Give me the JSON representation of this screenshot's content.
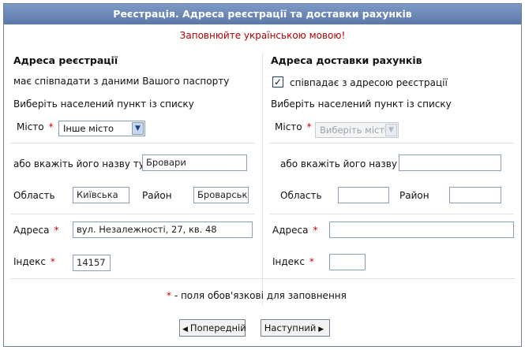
{
  "header": {
    "title": "Реєстрація. Адреса реєстрації та доставки рахунків",
    "notice": "Заповнюйте українською мовою!"
  },
  "registration": {
    "heading": "Адреса реєстрації",
    "passport_note": "має співпадати з даними Вашого паспорту",
    "choose_city_label": "Виберіть населений пункт із списку",
    "city_label": "Місто",
    "city_selected": "Інше місто",
    "city_name_label": "або вкажіть його назву тут",
    "city_name_value": "Бровари",
    "region_label": "Область",
    "region_value": "Київська",
    "district_label": "Район",
    "district_value": "Броварський",
    "address_label": "Адреса",
    "address_value": "вул. Незалежності, 27, кв. 48",
    "index_label": "Індекс",
    "index_value": "14157"
  },
  "delivery": {
    "heading": "Адреса доставки рахунків",
    "same_checkbox_label": "співпадає з адресою реєстрації",
    "same_checked": true,
    "check_mark": "✓",
    "choose_city_label": "Виберіть населений пункт із списку",
    "city_label": "Місто",
    "city_selected": "Виберіть місто",
    "city_name_label": "або вкажіть його назву тут",
    "city_name_value": "",
    "region_label": "Область",
    "region_value": "",
    "district_label": "Район",
    "district_value": "",
    "address_label": "Адреса",
    "address_value": "",
    "index_label": "Індекс",
    "index_value": ""
  },
  "footer": {
    "required_mark": "*",
    "required_note": " - поля обов'язкові для заповнення",
    "prev_label": "Попередній",
    "next_label": "Наступний"
  },
  "icons": {
    "dropdown": "chevron-down-icon",
    "prev": "triangle-left-icon",
    "next": "triangle-right-icon"
  },
  "colors": {
    "titlebar": "#6683b4",
    "notice": "#b00000",
    "required": "#d00000"
  }
}
